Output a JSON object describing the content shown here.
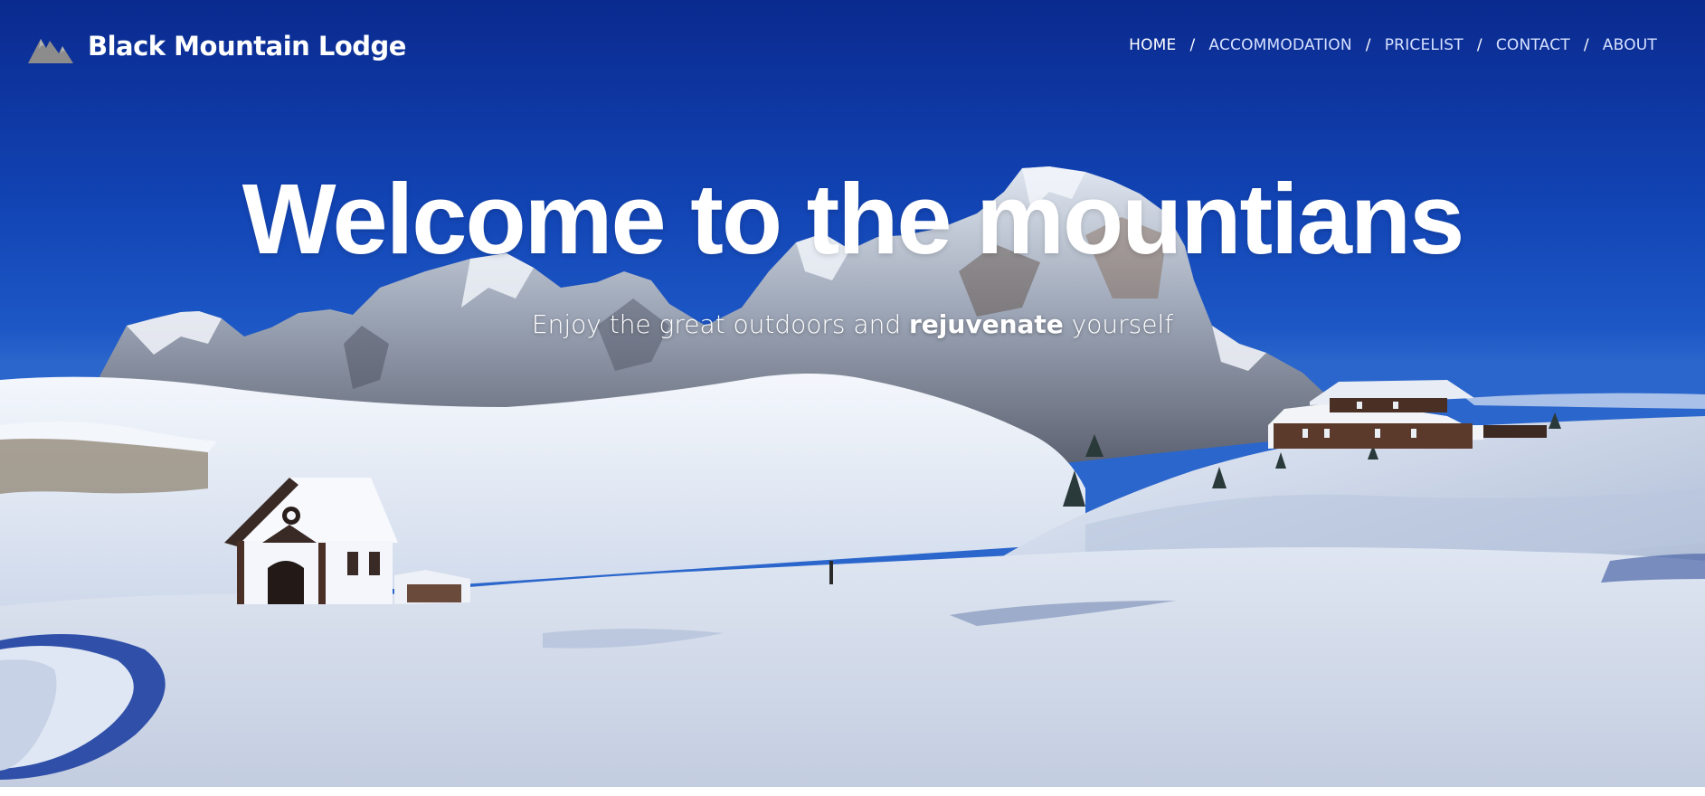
{
  "brand": {
    "name": "Black Mountain  Lodge",
    "logo_icon": "mountain-logo-icon"
  },
  "nav": {
    "items": [
      {
        "label": "HOME",
        "active": true
      },
      {
        "label": "ACCOMMODATION",
        "active": false
      },
      {
        "label": "PRICELIST",
        "active": false
      },
      {
        "label": "CONTACT",
        "active": false
      },
      {
        "label": "ABOUT",
        "active": false
      }
    ],
    "separator": "/"
  },
  "hero": {
    "title": "Welcome to the mountians",
    "subtitle_before": "Enjoy the great outdoors and ",
    "subtitle_bold": "rejuvenate",
    "subtitle_after": " yourself",
    "background": "snowy-mountain-landscape-photo"
  },
  "colors": {
    "sky_top": "#0a2a8f",
    "sky_mid": "#1d58c6",
    "text": "#ffffff",
    "logo_gray": "#8a8a8a"
  }
}
